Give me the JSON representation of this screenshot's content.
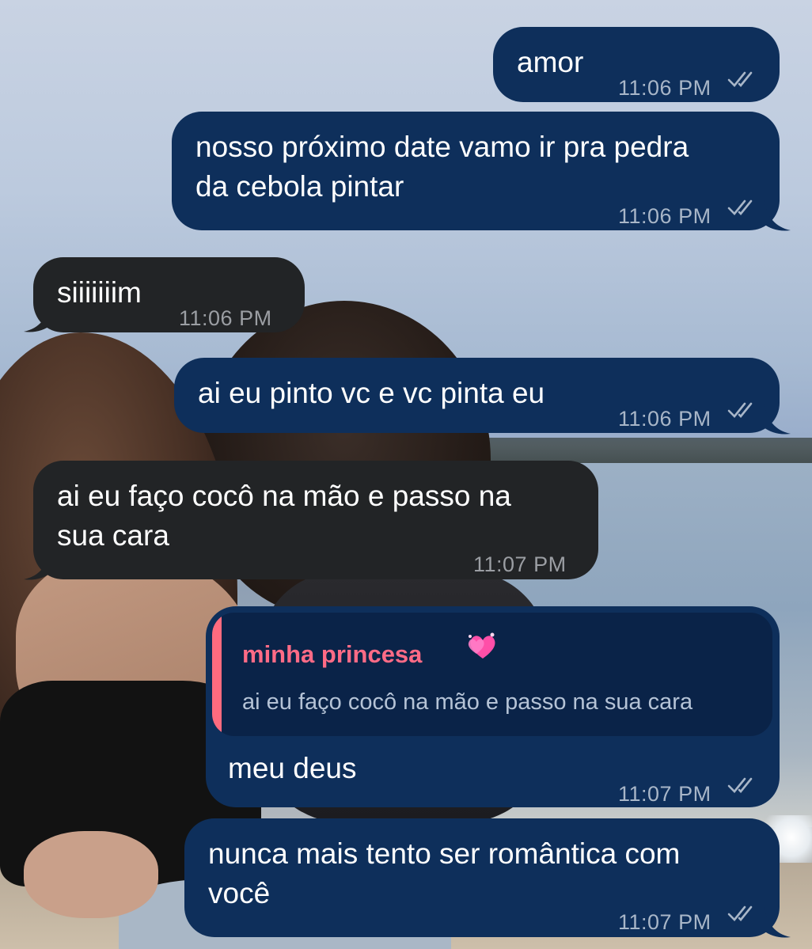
{
  "messages": [
    {
      "id": "m1",
      "direction": "outgoing",
      "text": "amor",
      "time": "11:06 PM",
      "status": "read"
    },
    {
      "id": "m2",
      "direction": "outgoing",
      "text": "nosso próximo date vamo ir pra pedra\nda cebola pintar",
      "time": "11:06 PM",
      "status": "read"
    },
    {
      "id": "m3",
      "direction": "incoming",
      "text": "siiiiiiim",
      "time": "11:06 PM"
    },
    {
      "id": "m4",
      "direction": "outgoing",
      "text": "ai eu pinto vc e vc pinta eu",
      "time": "11:06 PM",
      "status": "read"
    },
    {
      "id": "m5",
      "direction": "incoming",
      "text": "ai eu faço cocô na mão e passo na\nsua cara",
      "time": "11:07 PM"
    },
    {
      "id": "m6",
      "direction": "outgoing",
      "reply_to": {
        "sender": "minha princesa",
        "sender_icon": "sparkling-hearts-emoji",
        "text": "ai eu faço cocô na mão e passo na sua cara"
      },
      "text": "meu deus",
      "time": "11:07 PM",
      "status": "read"
    },
    {
      "id": "m7",
      "direction": "outgoing",
      "text": "nunca mais tento ser romântica com\nvocê",
      "time": "11:07 PM",
      "status": "read"
    }
  ],
  "colors": {
    "outgoing_bubble": "#0e2f5b",
    "incoming_bubble": "#222426",
    "reply_accent": "#ff6b7f",
    "timestamp": "#a8b6c8"
  },
  "icons": {
    "read_status": "double-check-icon"
  }
}
